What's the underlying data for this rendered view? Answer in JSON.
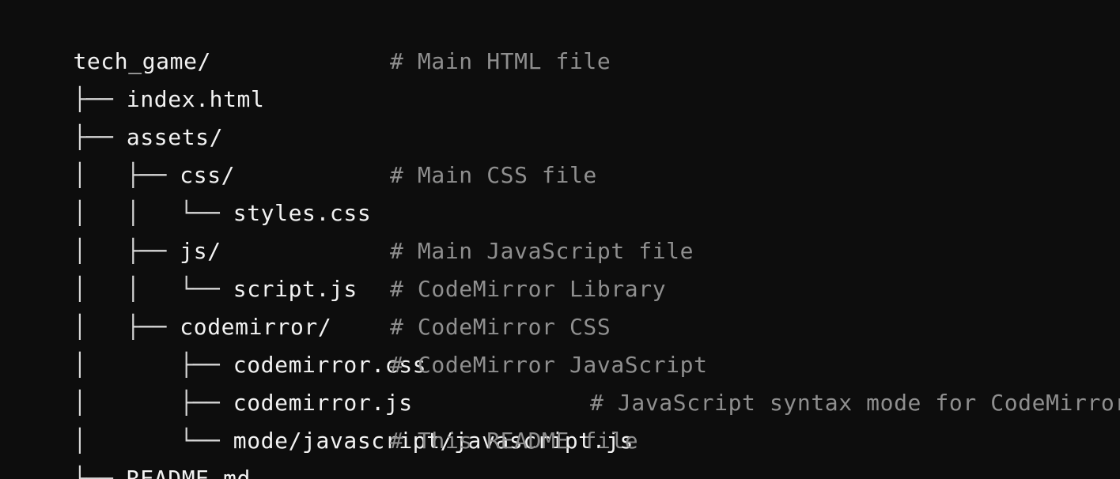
{
  "tree": {
    "lines": [
      {
        "prefix": "",
        "name": "tech_game/",
        "comment": ""
      },
      {
        "prefix": "├── ",
        "name": "index.html",
        "comment": "# Main HTML file"
      },
      {
        "prefix": "├── ",
        "name": "assets/",
        "comment": ""
      },
      {
        "prefix": "│   ├── ",
        "name": "css/",
        "comment": ""
      },
      {
        "prefix": "│   │   └── ",
        "name": "styles.css",
        "comment": "# Main CSS file"
      },
      {
        "prefix": "│   ├── ",
        "name": "js/",
        "comment": ""
      },
      {
        "prefix": "│   │   └── ",
        "name": "script.js",
        "comment": "# Main JavaScript file"
      },
      {
        "prefix": "│   ├── ",
        "name": "codemirror/",
        "comment": "# CodeMirror Library"
      },
      {
        "prefix": "│       ├── ",
        "name": "codemirror.css",
        "comment": "# CodeMirror CSS"
      },
      {
        "prefix": "│       ├── ",
        "name": "codemirror.js",
        "comment": "# CodeMirror JavaScript"
      },
      {
        "prefix": "│       └── ",
        "name": "mode/javascript/javascript.js",
        "comment": "# JavaScript syntax mode for CodeMirror"
      },
      {
        "prefix": "└── ",
        "name": "README.md",
        "comment": "# This README file"
      }
    ]
  },
  "colors": {
    "background": "#0d0d0d",
    "filename": "#f2f2f2",
    "comment": "#8f8f8f",
    "tree_lines": "#d6d6d6"
  }
}
